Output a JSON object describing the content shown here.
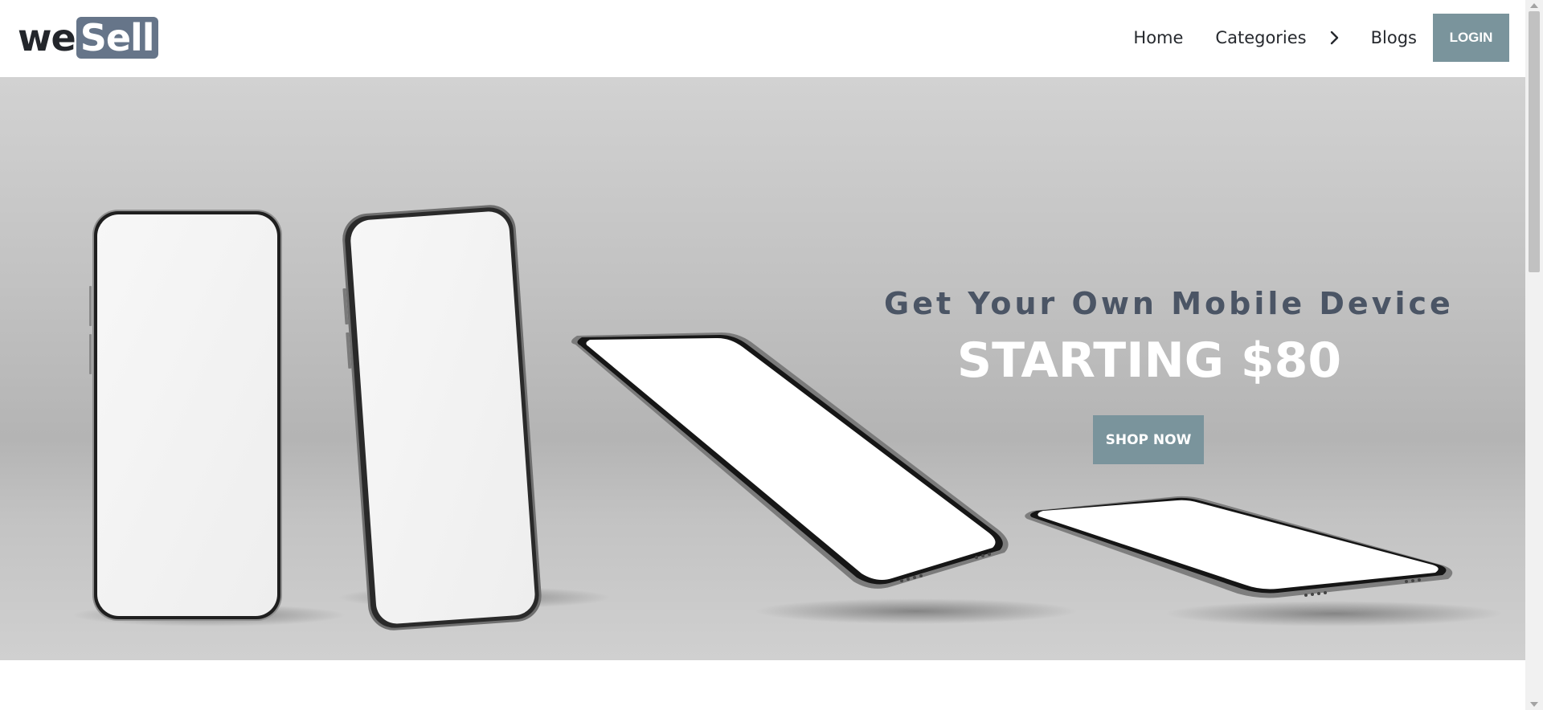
{
  "header": {
    "logo": {
      "part1": "we",
      "part2": "Sell"
    },
    "nav": [
      {
        "label": "Home"
      },
      {
        "label": "Categories"
      },
      {
        "label": "Blogs"
      }
    ],
    "login_label": "LOGIN"
  },
  "hero": {
    "headline": "Get Your Own Mobile Device",
    "price": "STARTING $80",
    "cta_label": "SHOP NOW"
  },
  "colors": {
    "accent": "#7a949c",
    "logo_badge": "#667589",
    "headline": "#4b5565",
    "hero_background": "#c3c3c3"
  },
  "icons": [
    "chevron-right-icon"
  ]
}
